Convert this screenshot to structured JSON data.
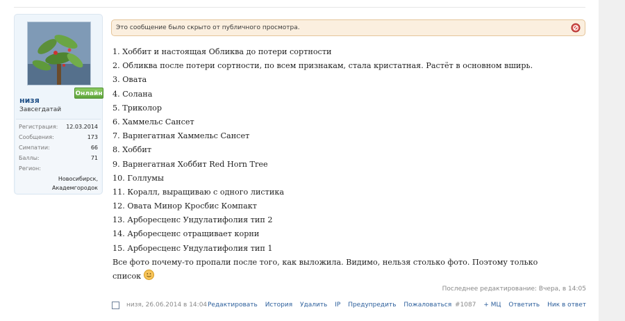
{
  "user": {
    "name": "низя",
    "title": "Завсегдатай",
    "online": "Онлайн",
    "stats": [
      {
        "label": "Регистрация:",
        "value": "12.03.2014"
      },
      {
        "label": "Сообщения:",
        "value": "173"
      },
      {
        "label": "Симпатии:",
        "value": "66"
      },
      {
        "label": "Баллы:",
        "value": "71"
      },
      {
        "label": "Регион:",
        "value": ""
      }
    ],
    "region_lines": [
      "Новосибирск,",
      "Академгородок"
    ]
  },
  "notice": {
    "text": "Это сообщение было скрыто от публичного просмотра."
  },
  "post": {
    "lines": [
      "1. Хоббит и настоящая Обликва до потери сортности",
      "2. Обликва после потери сортности, по всем признакам, стала кристатная. Растёт в основном вширь.",
      "3. Овата",
      "4. Солана",
      "5. Триколор",
      "6. Хаммельс Сансет",
      "7. Варнегатная Хаммельс Сансет",
      "8. Хоббит",
      "9. Варнегатная Хоббит Red Horn Tree",
      "10. Голлумы",
      "11. Коралл, выращиваю с одного листика",
      "12. Овата Минор Кросбис Компакт",
      "13. Арборесценс Ундулатифолия тип 2",
      "14. Арборесценс отращивает корни",
      "15. Арборесценс Ундулатифолия тип 1",
      "Все фото почему-то пропали после того, как выложила. Видимо, нельзя столько фото. Поэтому только",
      "список"
    ]
  },
  "edit_note": "Последнее редактирование: Вчера, в 14:05",
  "footer": {
    "meta": "низя, 26.06.2014 в 14:04",
    "actions": [
      "Редактировать",
      "История",
      "Удалить",
      "IP",
      "Предупредить",
      "Пожаловаться"
    ],
    "post_number": "#1087",
    "mq": "+ МЦ",
    "reply": "Ответить",
    "reply_to": "Ник в ответ"
  }
}
